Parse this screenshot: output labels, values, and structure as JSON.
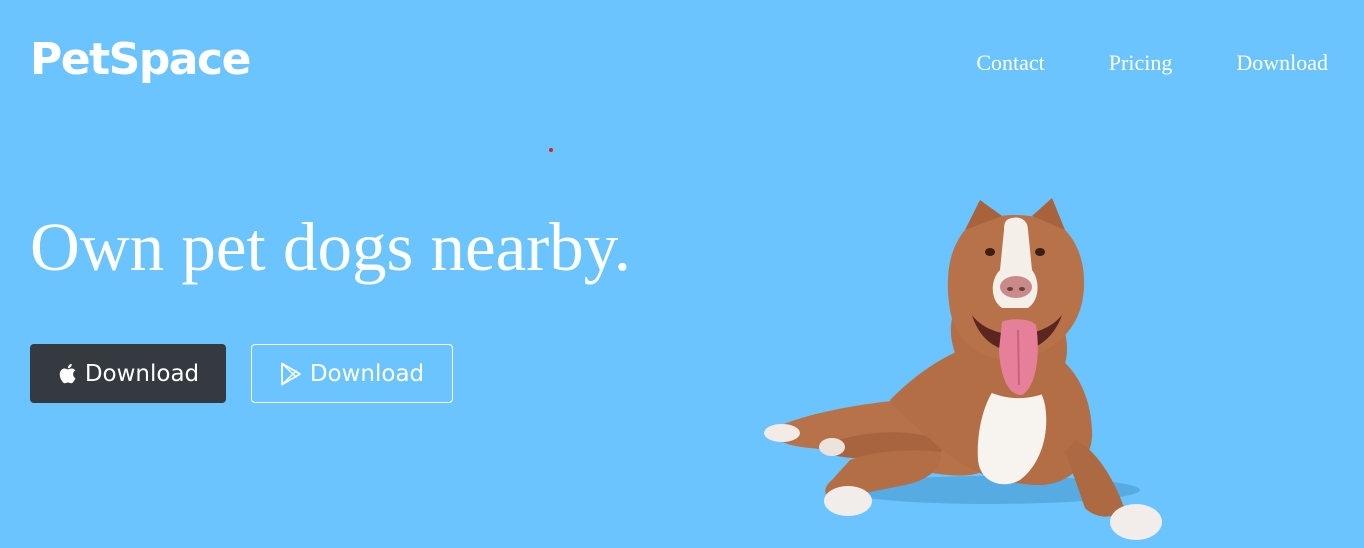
{
  "brand": {
    "logo_text": "PetSpace"
  },
  "nav": {
    "items": [
      {
        "label": "Contact"
      },
      {
        "label": "Pricing"
      },
      {
        "label": "Download"
      }
    ]
  },
  "hero": {
    "headline": "Own pet dogs nearby.",
    "buttons": [
      {
        "label": "Download",
        "icon": "apple-icon"
      },
      {
        "label": "Download",
        "icon": "google-play-icon"
      }
    ]
  },
  "colors": {
    "background": "#6bc4fe",
    "dark_button": "#343a40",
    "text": "#ffffff"
  }
}
